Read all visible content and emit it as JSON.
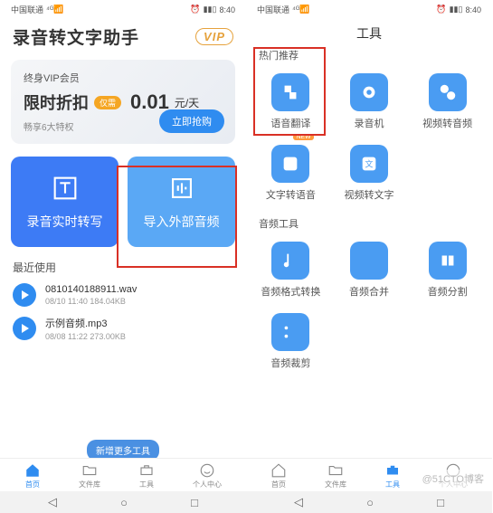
{
  "statusbar": {
    "carrier": "中国联通",
    "signal": "⁴ᴳ📶",
    "time": "8:40",
    "battery": "▮▮▯",
    "alarm": "⏰"
  },
  "left": {
    "title": "录音转文字助手",
    "vip": "VIP",
    "vipcard": {
      "line1": "终身VIP会员",
      "big": "限时折扣",
      "pill": "仅需",
      "price": "0.01",
      "unit": "元/天",
      "line3": "畅享6大特权",
      "buy": "立即抢购"
    },
    "card1": "录音实时转写",
    "card2": "导入外部音频",
    "recent_h": "最近使用",
    "items": [
      {
        "fn": "0810140188911.wav",
        "meta": "08/10 11:40   184.04KB"
      },
      {
        "fn": "示例音频.mp3",
        "meta": "08/08 11:22   273.00KB"
      }
    ],
    "notice": "新增更多工具",
    "tabs": [
      "首页",
      "文件库",
      "工具",
      "个人中心"
    ]
  },
  "right": {
    "title": "工具",
    "hot": "热门推荐",
    "grid1": [
      "语音翻译",
      "录音机",
      "视频转音频",
      "文字转语音",
      "视频转文字"
    ],
    "audio_h": "音频工具",
    "grid2": [
      "音频格式转换",
      "音频合并",
      "音频分割",
      "音频裁剪"
    ],
    "new": "NEW",
    "tabs": [
      "首页",
      "文件库",
      "工具",
      "个人中心"
    ]
  },
  "watermark": "@51CTO博客"
}
